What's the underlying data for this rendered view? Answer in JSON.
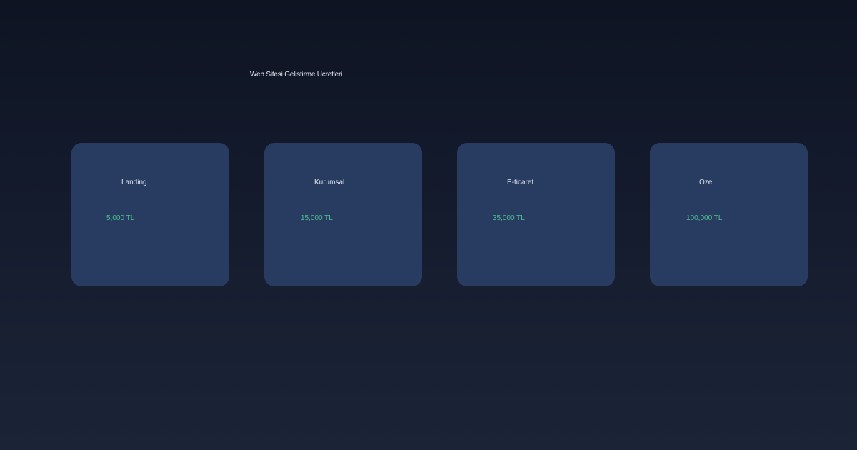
{
  "page": {
    "title": "Web Sitesi Gelistirme Ucretleri"
  },
  "plans": [
    {
      "name": "Landing",
      "price": "5,000 TL"
    },
    {
      "name": "Kurumsal",
      "price": "15,000 TL"
    },
    {
      "name": "E-ticaret",
      "price": "35,000 TL"
    },
    {
      "name": "Ozel",
      "price": "100,000 TL"
    }
  ],
  "colors": {
    "background_top": "#0e1422",
    "background_bottom": "#1b2437",
    "card": "#283b61",
    "title_text": "#e6ebf4",
    "plan_name_text": "#dfe5ef",
    "price_text": "#4fc28f"
  }
}
